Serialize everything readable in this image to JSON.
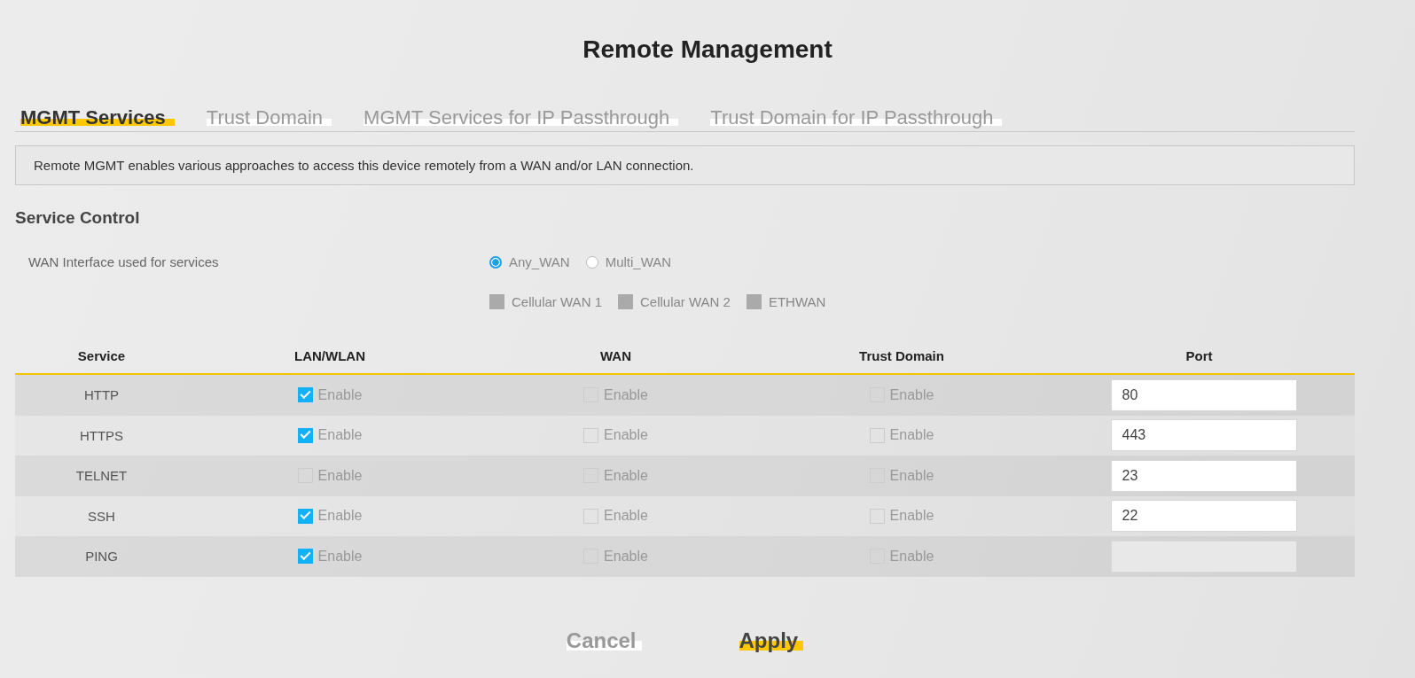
{
  "title": "Remote Management",
  "tabs": [
    {
      "label": "MGMT Services",
      "selected": true
    },
    {
      "label": "Trust Domain",
      "selected": false
    },
    {
      "label": "MGMT Services for IP Passthrough",
      "selected": false
    },
    {
      "label": "Trust Domain for IP Passthrough",
      "selected": false
    }
  ],
  "info": "Remote MGMT enables various approaches to access this device remotely from a WAN and/or LAN connection.",
  "section_title": "Service Control",
  "wan_interface": {
    "label": "WAN Interface used for services",
    "radios": [
      {
        "label": "Any_WAN",
        "selected": true
      },
      {
        "label": "Multi_WAN",
        "selected": false
      }
    ],
    "checkboxes": [
      {
        "label": "Cellular WAN 1",
        "disabled": true
      },
      {
        "label": "Cellular WAN 2",
        "disabled": true
      },
      {
        "label": "ETHWAN",
        "disabled": true
      }
    ]
  },
  "table": {
    "columns": [
      "Service",
      "LAN/WLAN",
      "WAN",
      "Trust Domain",
      "Port"
    ],
    "rows": [
      {
        "service": "HTTP",
        "lan_wlan": {
          "label": "Enable",
          "checked": true
        },
        "wan": {
          "label": "Enable",
          "checked": false
        },
        "trust_domain": {
          "label": "Enable",
          "checked": false
        },
        "port": {
          "value": "80",
          "disabled": false
        }
      },
      {
        "service": "HTTPS",
        "lan_wlan": {
          "label": "Enable",
          "checked": true
        },
        "wan": {
          "label": "Enable",
          "checked": false
        },
        "trust_domain": {
          "label": "Enable",
          "checked": false
        },
        "port": {
          "value": "443",
          "disabled": false
        }
      },
      {
        "service": "TELNET",
        "lan_wlan": {
          "label": "Enable",
          "checked": false
        },
        "wan": {
          "label": "Enable",
          "checked": false
        },
        "trust_domain": {
          "label": "Enable",
          "checked": false
        },
        "port": {
          "value": "23",
          "disabled": false
        }
      },
      {
        "service": "SSH",
        "lan_wlan": {
          "label": "Enable",
          "checked": true
        },
        "wan": {
          "label": "Enable",
          "checked": false
        },
        "trust_domain": {
          "label": "Enable",
          "checked": false
        },
        "port": {
          "value": "22",
          "disabled": false
        }
      },
      {
        "service": "PING",
        "lan_wlan": {
          "label": "Enable",
          "checked": true
        },
        "wan": {
          "label": "Enable",
          "checked": false
        },
        "trust_domain": {
          "label": "Enable",
          "checked": false
        },
        "port": {
          "disabled": true
        }
      }
    ]
  },
  "buttons": [
    {
      "label": "Cancel",
      "kind": "secondary"
    },
    {
      "label": "Apply",
      "kind": "primary"
    }
  ]
}
